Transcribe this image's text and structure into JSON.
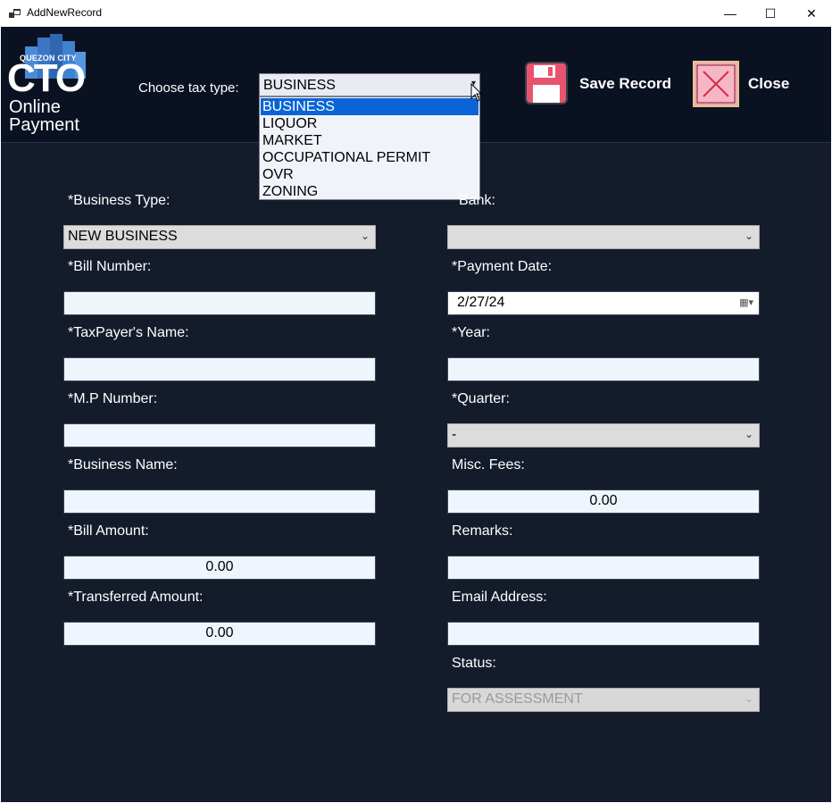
{
  "window": {
    "title": "AddNewRecord",
    "minimize": "—",
    "maximize": "☐",
    "close": "✕"
  },
  "logo": {
    "line1": "QUEZON CITY",
    "line2": "CTO",
    "line3": "Online",
    "line4": "Payment"
  },
  "header": {
    "choose_label": "Choose tax type:",
    "tax_type_value": "BUSINESS",
    "tax_type_options": [
      "BUSINESS",
      "LIQUOR",
      "MARKET",
      "OCCUPATIONAL PERMIT",
      "OVR",
      "ZONING"
    ],
    "selected_option_index": 0,
    "save_label": "Save Record",
    "close_label": "Close"
  },
  "form": {
    "business_type_label": "*Business Type:",
    "business_type_value": "NEW BUSINESS",
    "bill_number_label": "*Bill Number:",
    "bill_number_value": "",
    "taxpayer_name_label": "*TaxPayer's Name:",
    "taxpayer_name_value": "",
    "mp_number_label": "*M.P Number:",
    "mp_number_value": "",
    "business_name_label": "*Business Name:",
    "business_name_value": "",
    "bill_amount_label": "*Bill Amount:",
    "bill_amount_value": "0.00",
    "transferred_amount_label": "*Transferred Amount:",
    "transferred_amount_value": "0.00",
    "bank_label": "Bank:",
    "bank_value": "",
    "payment_date_label": "*Payment Date:",
    "payment_date_value": "2/27/24",
    "year_label": "*Year:",
    "year_value": "",
    "quarter_label": "*Quarter:",
    "quarter_value": "-",
    "misc_fees_label": "Misc. Fees:",
    "misc_fees_value": "0.00",
    "remarks_label": "Remarks:",
    "remarks_value": "",
    "email_label": "Email Address:",
    "email_value": "",
    "status_label": "Status:",
    "status_value": "FOR ASSESSMENT"
  },
  "colors": {
    "background": "#141c2c",
    "header_background": "#0a1222",
    "selection": "#0a64d6",
    "save_icon": "#e8546e",
    "close_icon": "#f3a6b8"
  },
  "icons": {
    "window_icon": "app-window-icon",
    "save": "floppy-disk-icon",
    "close": "close-x-icon",
    "dropdown": "chevron-down-icon",
    "calendar": "calendar-icon"
  }
}
